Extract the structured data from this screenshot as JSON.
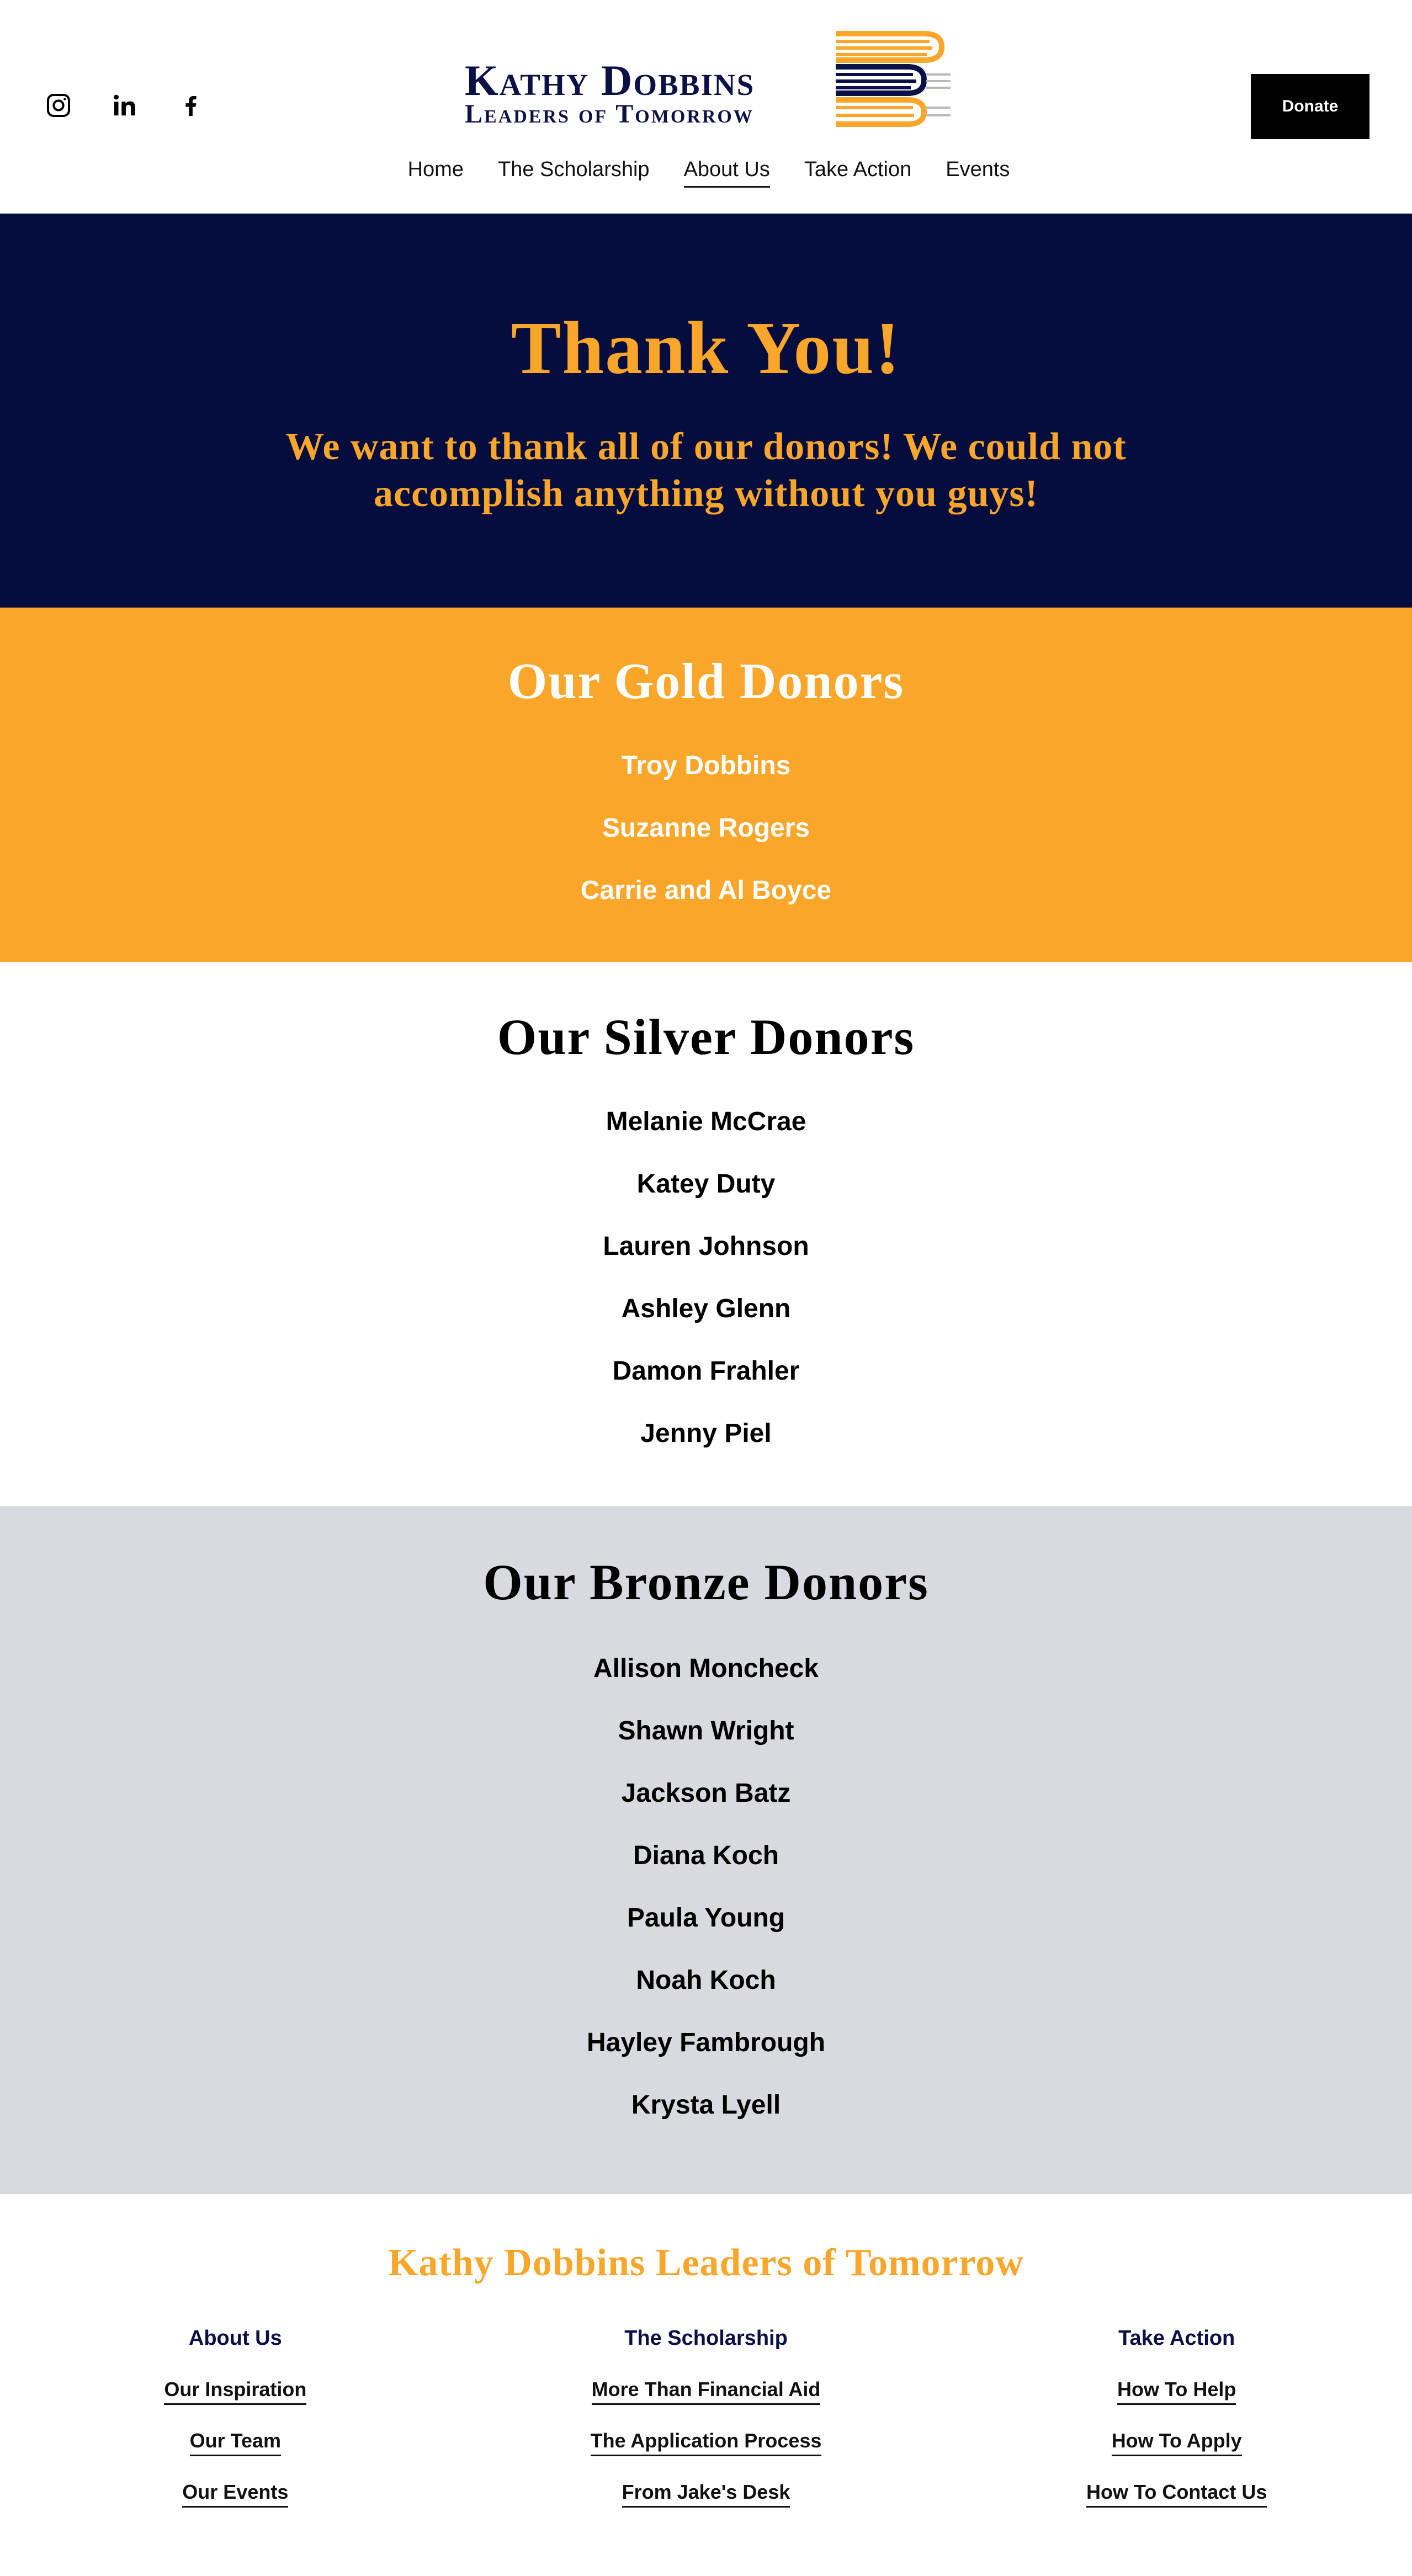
{
  "header": {
    "social": [
      {
        "name": "instagram-icon",
        "label": "Instagram"
      },
      {
        "name": "linkedin-icon",
        "label": "LinkedIn"
      },
      {
        "name": "facebook-icon",
        "label": "Facebook"
      }
    ],
    "logo": {
      "line1": "Kathy Dobbins",
      "line2": "Leaders of Tomorrow"
    },
    "donate_label": "Donate",
    "nav": [
      "Home",
      "The Scholarship",
      "About Us",
      "Take Action",
      "Events"
    ],
    "nav_active": "About Us"
  },
  "hero": {
    "title": "Thank You!",
    "subtitle": "We want to thank all of our donors! We could not accomplish anything without you guys!"
  },
  "gold": {
    "title": "Our Gold Donors",
    "names": [
      "Troy Dobbins",
      "Suzanne Rogers",
      "Carrie and Al Boyce"
    ]
  },
  "silver": {
    "title": "Our Silver Donors",
    "names": [
      "Melanie McCrae",
      "Katey Duty",
      "Lauren Johnson",
      "Ashley Glenn",
      "Damon Frahler",
      "Jenny Piel"
    ]
  },
  "bronze": {
    "title": "Our Bronze Donors",
    "names": [
      "Allison Moncheck",
      "Shawn Wright",
      "Jackson Batz",
      "Diana Koch",
      "Paula Young",
      "Noah Koch",
      "Hayley Fambrough",
      "Krysta Lyell"
    ]
  },
  "footer": {
    "title": "Kathy Dobbins Leaders of Tomorrow",
    "columns": [
      {
        "heading": "About Us",
        "links": [
          "Our Inspiration",
          "Our Team",
          "Our Events"
        ]
      },
      {
        "heading": "The Scholarship",
        "links": [
          "More Than Financial Aid",
          "The Application Process",
          "From Jake's Desk"
        ]
      },
      {
        "heading": "Take Action",
        "links": [
          "How To Help",
          "How To Apply",
          "How To Contact Us"
        ]
      }
    ]
  },
  "colors": {
    "navy": "#050c3e",
    "gold": "#f9a62a",
    "bronze_bg": "#d8dae0"
  }
}
